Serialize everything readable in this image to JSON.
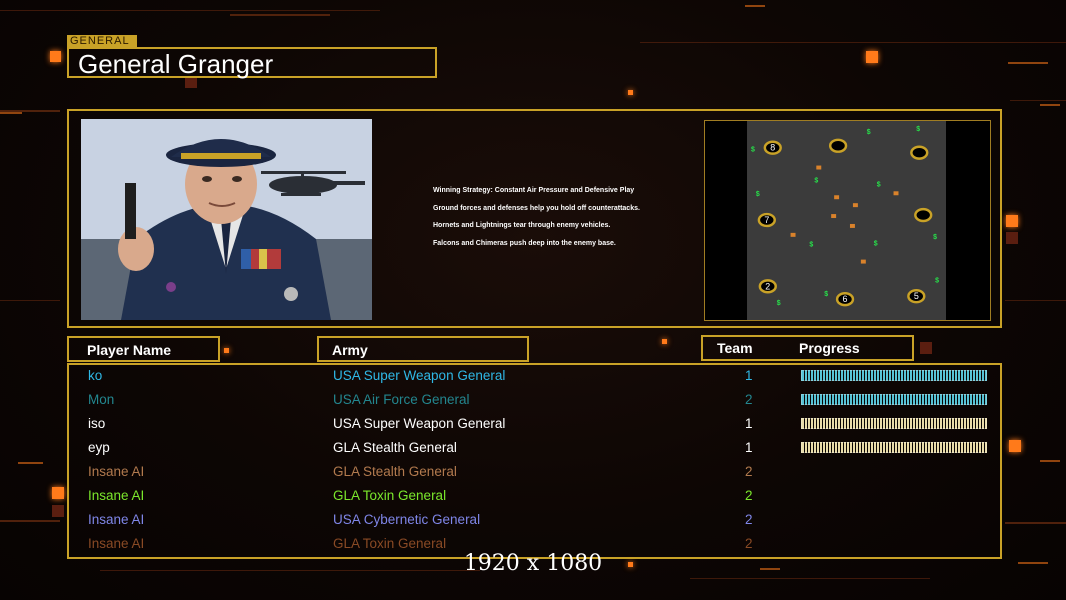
{
  "header": {
    "tag": "GENERAL",
    "title": "General Granger"
  },
  "strategy": {
    "lines": [
      "Winning Strategy: Constant Air Pressure and Defensive Play",
      "Ground forces and defenses help you hold off counterattacks.",
      "Hornets and Lightnings tear through enemy vehicles.",
      "Falcons and Chimeras push deep into the enemy base."
    ]
  },
  "minimap": {
    "start_positions": [
      "8",
      "7",
      "2",
      "6",
      "5"
    ],
    "supply_symbol": "$"
  },
  "columns": {
    "player_name": "Player Name",
    "army": "Army",
    "team": "Team",
    "progress": "Progress"
  },
  "players": [
    {
      "name": "ko",
      "army": "USA Super Weapon General",
      "team": "1",
      "color": "#2fb8e6",
      "progress": 1.0
    },
    {
      "name": "Mon",
      "army": "USA Air Force General",
      "team": "2",
      "color": "#23868f",
      "progress": 1.0
    },
    {
      "name": "iso",
      "army": "USA Super Weapon General",
      "team": "1",
      "color": "#ffffff",
      "progress": 1.0
    },
    {
      "name": "eyp",
      "army": "GLA Stealth General",
      "team": "1",
      "color": "#ffffff",
      "progress": 1.0
    },
    {
      "name": "Insane AI",
      "army": "GLA Stealth General",
      "team": "2",
      "color": "#b27a4e",
      "progress": null
    },
    {
      "name": "Insane AI",
      "army": "GLA Toxin General",
      "team": "2",
      "color": "#7be82c",
      "progress": null
    },
    {
      "name": "Insane AI",
      "army": "USA Cybernetic General",
      "team": "2",
      "color": "#7f86e8",
      "progress": null
    },
    {
      "name": "Insane AI",
      "army": "GLA Toxin General",
      "team": "2",
      "color": "#8a4a25",
      "progress": null
    }
  ],
  "progress_bar_colors": [
    "#57c3d6",
    "#57c3d6",
    "#e9dca9",
    "#e9dca9"
  ],
  "footer": {
    "resolution": "1920 x 1080"
  },
  "theme": {
    "frame_gold": "#c9a227",
    "accent_orange": "#ff7a1a"
  }
}
